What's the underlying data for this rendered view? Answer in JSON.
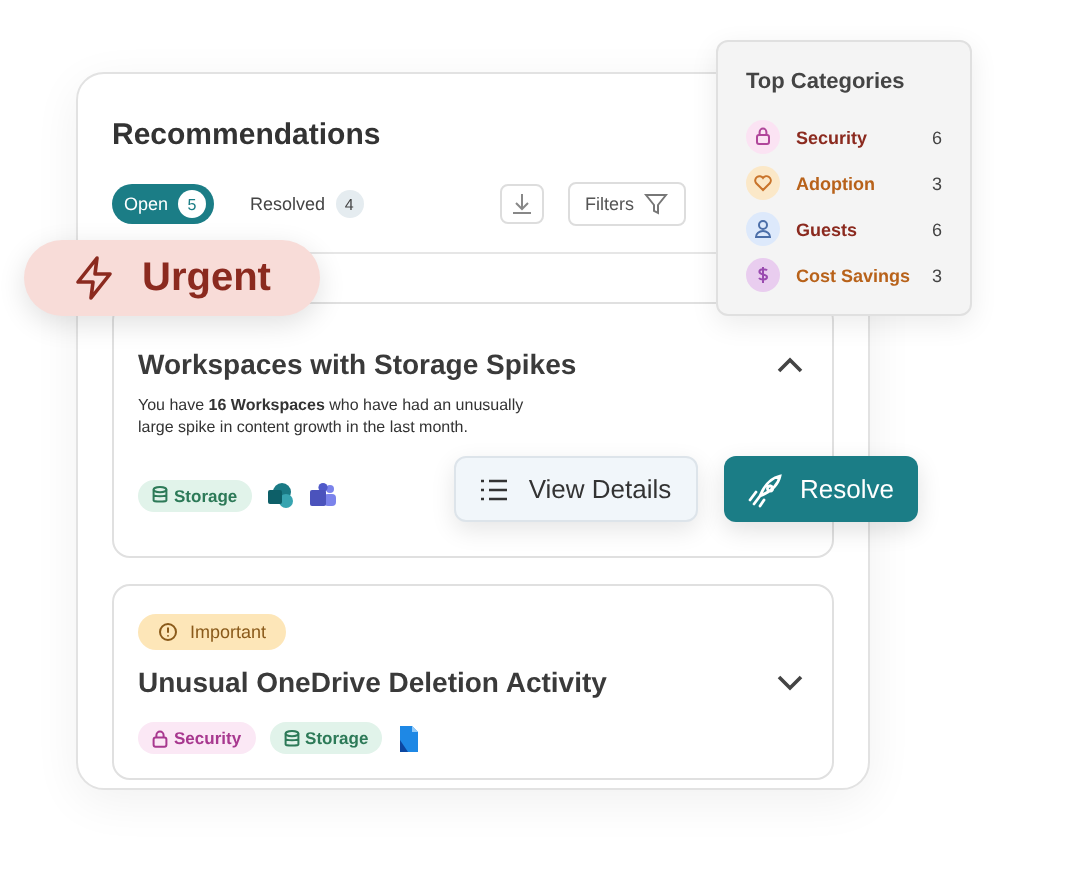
{
  "panel": {
    "title": "Recommendations",
    "tabs": [
      {
        "label": "Open",
        "count": "5",
        "selected": true
      },
      {
        "label": "Resolved",
        "count": "4",
        "selected": false
      }
    ],
    "filters_label": "Filters"
  },
  "urgent_badge": {
    "label": "Urgent"
  },
  "recommendations": [
    {
      "title": "Workspaces with Storage Spikes",
      "description": "You have **16 Workspaces** who have had an unusually large spike in content growth in the last month.",
      "expanded": true,
      "tags": [
        {
          "label": "Storage",
          "kind": "storage"
        }
      ],
      "apps": [
        {
          "kind": "sharepoint"
        },
        {
          "kind": "teams"
        }
      ]
    },
    {
      "priority": "Important",
      "title": "Unusual OneDrive Deletion Activity",
      "expanded": false,
      "tags": [
        {
          "label": "Security",
          "kind": "security"
        },
        {
          "label": "Storage",
          "kind": "storage"
        }
      ],
      "apps": [
        {
          "kind": "onedrive"
        }
      ]
    }
  ],
  "actions": {
    "view_details": "View Details",
    "resolve": "Resolve"
  },
  "top_categories": {
    "title": "Top Categories",
    "items": [
      {
        "label": "Security",
        "count": "6",
        "kind": "security"
      },
      {
        "label": "Adoption",
        "count": "3",
        "kind": "adoption"
      },
      {
        "label": "Guests",
        "count": "6",
        "kind": "guests"
      },
      {
        "label": "Cost Savings",
        "count": "3",
        "kind": "cost"
      }
    ]
  }
}
